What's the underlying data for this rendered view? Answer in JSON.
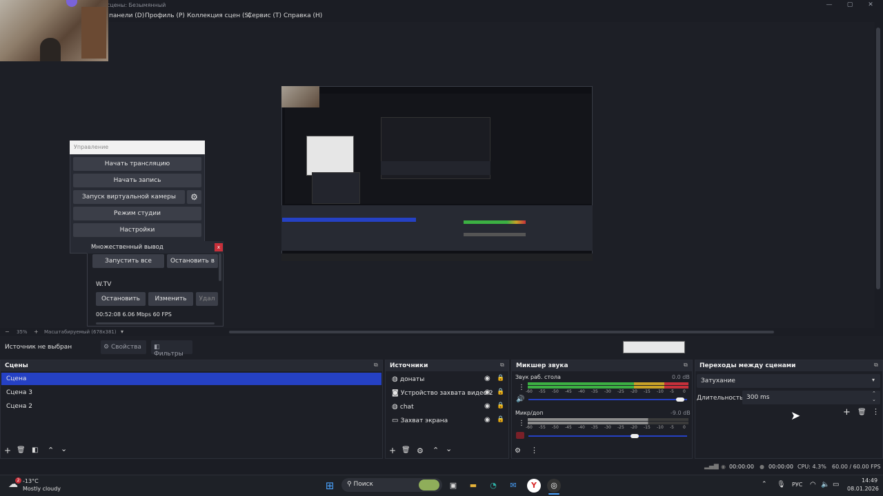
{
  "window": {
    "title": "сцены: Безымянный",
    "min": "—",
    "max": "▢",
    "close": "✕"
  },
  "menu": [
    "панели (D)",
    "Профиль (P)",
    "Коллекция сцен (S)",
    "Сервис (T)",
    "Справка (H)"
  ],
  "controls": {
    "title": "Управление",
    "buttons": [
      "Начать трансляцию",
      "Начать запись",
      "Запуск виртуальной камеры",
      "Режим студии",
      "Настройки"
    ]
  },
  "multi_output": {
    "title": "Множественный вывод",
    "close": "x",
    "start_all": "Запустить все",
    "stop_all": "Остановить в",
    "target_name": "W.TV",
    "stop": "Остановить",
    "edit": "Изменить",
    "delete": "Удал",
    "stats": "00:52:08  6.06 Mbps  60 FPS"
  },
  "preview_status": {
    "minus": "−",
    "zoom": "35%",
    "plus": "+",
    "scale": "Масштабируемый (678x381)",
    "dropdown": "▾"
  },
  "source_bar": {
    "no_source": "Источник не выбран",
    "properties": "Свойства",
    "filters": "Фильтры"
  },
  "scenes": {
    "title": "Сцены",
    "items": [
      "Сцена",
      "Сцена 3",
      "Сцена 2"
    ],
    "selected": 0
  },
  "sources": {
    "title": "Источники",
    "items": [
      {
        "icon": "globe-icon",
        "label": "донаты"
      },
      {
        "icon": "camera-icon",
        "label": "Устройство захвата видео 2"
      },
      {
        "icon": "globe-icon",
        "label": "chat"
      },
      {
        "icon": "monitor-icon",
        "label": "Захват экрана"
      }
    ]
  },
  "mixer": {
    "title": "Микшер звука",
    "channels": [
      {
        "name": "Звук раб. стола",
        "db": "0.0 dB",
        "level": 1.0,
        "volume": 0.98,
        "muted": false
      },
      {
        "name": "Микр/доп",
        "db": "-9.0 dB",
        "level": 0.75,
        "volume": 0.68,
        "muted": true
      }
    ],
    "ticks": [
      "-60",
      "-55",
      "-50",
      "-45",
      "-40",
      "-35",
      "-30",
      "-25",
      "-20",
      "-15",
      "-10",
      "-5",
      "0"
    ]
  },
  "transitions": {
    "title": "Переходы между сценами",
    "type": "Затухание",
    "duration_label": "Длительность",
    "duration": "300 ms"
  },
  "status": {
    "stream_time": "00:00:00",
    "rec_time": "00:00:00",
    "cpu": "CPU: 4.3%",
    "fps": "60.00 / 60.00 FPS"
  },
  "taskbar": {
    "weather_temp": "-13°C",
    "weather_desc": "Mostly cloudy",
    "weather_badge": "2",
    "search": "Поиск",
    "lang": "РУС",
    "time": "14:49",
    "date": "08.01.2026"
  },
  "colors": {
    "accent": "#2541c4",
    "meter_green": "#3cb043",
    "meter_yellow": "#c9a227",
    "meter_red": "#c7303a"
  }
}
